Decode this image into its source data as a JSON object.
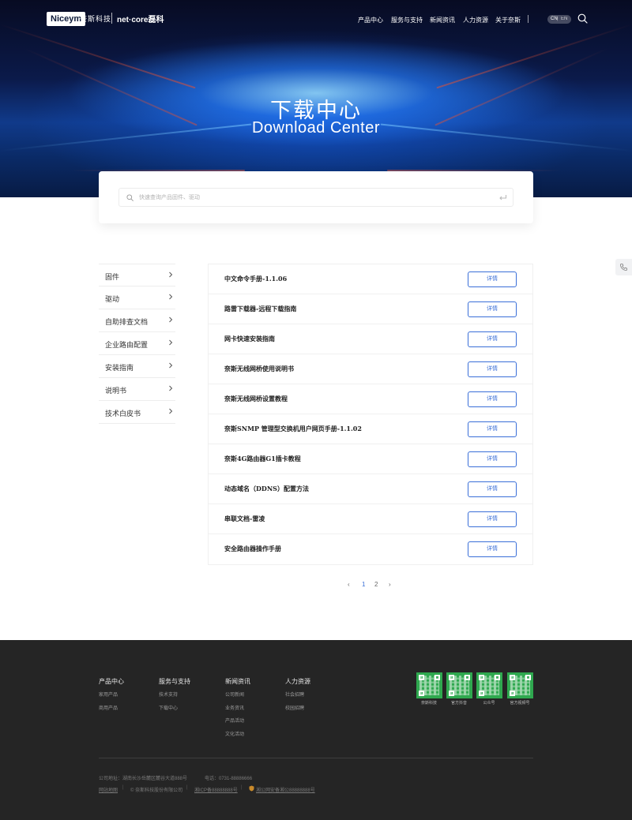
{
  "header": {
    "logo_box": "Niceym",
    "logo_cn": "奈斯科技",
    "logo_brand2": "net·core磊科",
    "nav": [
      "产品中心",
      "服务与支持",
      "新闻资讯",
      "人力资源",
      "关于奈斯"
    ],
    "lang_cn": "CN",
    "lang_sep": "|",
    "lang_en": "EN"
  },
  "hero": {
    "title_cn": "下载中心",
    "title_en": "Download Center"
  },
  "search": {
    "placeholder": "快速查询产品固件、驱动"
  },
  "sidebar": {
    "items": [
      "固件",
      "驱动",
      "自助排查文档",
      "企业路由配置",
      "安装指南",
      "说明书",
      "技术白皮书"
    ]
  },
  "list": {
    "button_label": "详情",
    "items": [
      "中文命令手册-1.1.06",
      "路雷下载器-远程下载指南",
      "网卡快速安装指南",
      "奈斯无线网桥使用说明书",
      "奈斯无线网桥设置教程",
      "奈斯SNMP 管理型交换机用户网页手册-1.1.02",
      "奈斯4G路由器G1插卡教程",
      "动态域名（DDNS）配置方法",
      "串联文档-雷凌",
      "安全路由器操作手册"
    ]
  },
  "pagination": {
    "prev": "‹",
    "pages": [
      "1",
      "2"
    ],
    "next": "›",
    "active": "1"
  },
  "footer": {
    "columns": [
      {
        "title": "产品中心",
        "links": [
          "家用产品",
          "商用产品"
        ]
      },
      {
        "title": "服务与支持",
        "links": [
          "技术支持",
          "下载中心"
        ]
      },
      {
        "title": "新闻资讯",
        "links": [
          "公司新闻",
          "业务资讯",
          "产品活动",
          "文化活动"
        ]
      },
      {
        "title": "人力资源",
        "links": [
          "社会招聘",
          "校园招聘"
        ]
      }
    ],
    "qr_captions": [
      "奈斯科技",
      "官方抖音",
      "公众号",
      "官方视频号"
    ],
    "address": "公司地址：湖南长沙岳麓区麓谷大道888号",
    "phone": "电话：0731-88886666",
    "site_map": "网站地图",
    "copyright": "© 奈斯科技股份有限公司",
    "icp": "湘ICP备88888888号",
    "police": "湘公网安备湘公88888888号"
  },
  "colors": {
    "accent": "#3a6fd8",
    "footer_bg": "#252525",
    "qr_green": "#2fa84f"
  }
}
